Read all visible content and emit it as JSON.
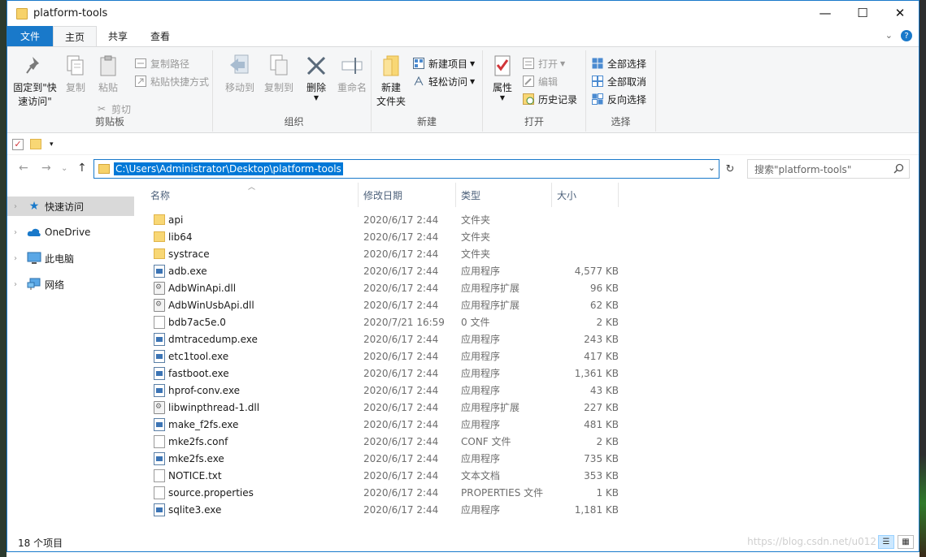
{
  "window": {
    "title": "platform-tools"
  },
  "tabs": [
    "文件",
    "主页",
    "共享",
    "查看"
  ],
  "ribbon": {
    "clipboard": {
      "label": "剪贴板",
      "pin": "固定到\"快\n速访问\"",
      "copy": "复制",
      "paste": "粘贴",
      "copy_path": "复制路径",
      "paste_shortcut": "粘贴快捷方式",
      "cut": "剪切"
    },
    "organize": {
      "label": "组织",
      "move_to": "移动到",
      "copy_to": "复制到",
      "delete": "删除",
      "rename": "重命名"
    },
    "new": {
      "label": "新建",
      "new_folder": "新建\n文件夹",
      "new_item": "新建项目",
      "easy_access": "轻松访问"
    },
    "open": {
      "label": "打开",
      "properties": "属性",
      "open": "打开",
      "edit": "编辑",
      "history": "历史记录"
    },
    "select": {
      "label": "选择",
      "select_all": "全部选择",
      "select_none": "全部取消",
      "invert": "反向选择"
    }
  },
  "address": {
    "path": "C:\\Users\\Administrator\\Desktop\\platform-tools",
    "search_placeholder": "搜索\"platform-tools\""
  },
  "nav": [
    "快速访问",
    "OneDrive",
    "此电脑",
    "网络"
  ],
  "columns": {
    "name": "名称",
    "date": "修改日期",
    "type": "类型",
    "size": "大小"
  },
  "files": [
    {
      "name": "api",
      "date": "2020/6/17 2:44",
      "type": "文件夹",
      "size": "",
      "icon": "folder"
    },
    {
      "name": "lib64",
      "date": "2020/6/17 2:44",
      "type": "文件夹",
      "size": "",
      "icon": "folder"
    },
    {
      "name": "systrace",
      "date": "2020/6/17 2:44",
      "type": "文件夹",
      "size": "",
      "icon": "folder"
    },
    {
      "name": "adb.exe",
      "date": "2020/6/17 2:44",
      "type": "应用程序",
      "size": "4,577 KB",
      "icon": "exe"
    },
    {
      "name": "AdbWinApi.dll",
      "date": "2020/6/17 2:44",
      "type": "应用程序扩展",
      "size": "96 KB",
      "icon": "dll"
    },
    {
      "name": "AdbWinUsbApi.dll",
      "date": "2020/6/17 2:44",
      "type": "应用程序扩展",
      "size": "62 KB",
      "icon": "dll"
    },
    {
      "name": "bdb7ac5e.0",
      "date": "2020/7/21 16:59",
      "type": "0 文件",
      "size": "2 KB",
      "icon": "file"
    },
    {
      "name": "dmtracedump.exe",
      "date": "2020/6/17 2:44",
      "type": "应用程序",
      "size": "243 KB",
      "icon": "exe"
    },
    {
      "name": "etc1tool.exe",
      "date": "2020/6/17 2:44",
      "type": "应用程序",
      "size": "417 KB",
      "icon": "exe"
    },
    {
      "name": "fastboot.exe",
      "date": "2020/6/17 2:44",
      "type": "应用程序",
      "size": "1,361 KB",
      "icon": "exe"
    },
    {
      "name": "hprof-conv.exe",
      "date": "2020/6/17 2:44",
      "type": "应用程序",
      "size": "43 KB",
      "icon": "exe"
    },
    {
      "name": "libwinpthread-1.dll",
      "date": "2020/6/17 2:44",
      "type": "应用程序扩展",
      "size": "227 KB",
      "icon": "dll"
    },
    {
      "name": "make_f2fs.exe",
      "date": "2020/6/17 2:44",
      "type": "应用程序",
      "size": "481 KB",
      "icon": "exe"
    },
    {
      "name": "mke2fs.conf",
      "date": "2020/6/17 2:44",
      "type": "CONF 文件",
      "size": "2 KB",
      "icon": "file"
    },
    {
      "name": "mke2fs.exe",
      "date": "2020/6/17 2:44",
      "type": "应用程序",
      "size": "735 KB",
      "icon": "exe"
    },
    {
      "name": "NOTICE.txt",
      "date": "2020/6/17 2:44",
      "type": "文本文档",
      "size": "353 KB",
      "icon": "file"
    },
    {
      "name": "source.properties",
      "date": "2020/6/17 2:44",
      "type": "PROPERTIES 文件",
      "size": "1 KB",
      "icon": "file"
    },
    {
      "name": "sqlite3.exe",
      "date": "2020/6/17 2:44",
      "type": "应用程序",
      "size": "1,181 KB",
      "icon": "exe"
    }
  ],
  "status": {
    "count": "18 个项目",
    "watermark": "https://blog.csdn.net/u012"
  },
  "colors": {
    "accent": "#1979ca",
    "selection": "#0078d7",
    "ribbon_bg": "#f5f6f7"
  }
}
